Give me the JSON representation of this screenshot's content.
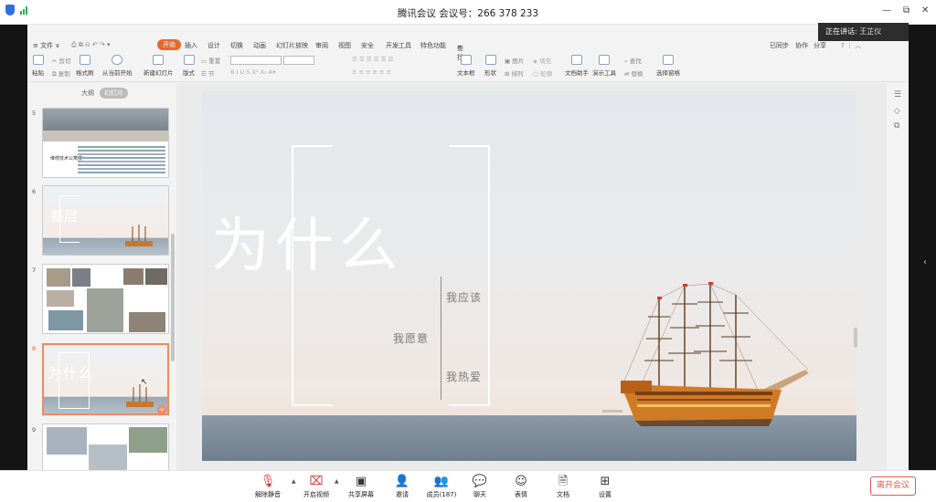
{
  "window": {
    "title": "腾讯会议 会议号：266 378 233",
    "minimize": "—",
    "restore": "⧉",
    "close": "✕"
  },
  "speaker": {
    "label": "正在讲话: ",
    "name": "王芷仪"
  },
  "wps": {
    "menu": {
      "file": "≡ 文件 ∨",
      "tabs": [
        "开始",
        "插入",
        "设计",
        "切换",
        "动画",
        "幻灯片放映",
        "审阅",
        "视图",
        "安全",
        "开发工具",
        "特色功能"
      ],
      "active_tab": "开始",
      "search": "查找",
      "sync": "已同步",
      "collab": "协作",
      "share": "分享"
    },
    "ribbon": {
      "paste": "粘贴",
      "cut": "剪切",
      "copy": "复制",
      "format_painter": "格式刷",
      "from_current": "从当前开始",
      "new_slide": "新建幻灯片",
      "layout": "版式",
      "section": "节",
      "reset": "重置",
      "textbox": "文本框",
      "shape": "形状",
      "arrange": "排列",
      "picture": "图片",
      "fill": "填充",
      "outline": "轮廓",
      "doc_assistant": "文档助手",
      "present_tool": "演示工具",
      "find": "查找",
      "replace": "替换",
      "select_pane": "选择窗格"
    },
    "panel": {
      "tab_outline": "大纲",
      "tab_slides": "幻灯片"
    },
    "thumbs": [
      {
        "num": "5",
        "text": "维修技术公寓楼"
      },
      {
        "num": "6",
        "text": "基层"
      },
      {
        "num": "7",
        "text": ""
      },
      {
        "num": "8",
        "text": "为什么"
      },
      {
        "num": "9",
        "text": ""
      }
    ],
    "slide": {
      "title": "为什么",
      "line1": "我应该",
      "line2": "我愿意",
      "line3": "我热爱"
    }
  },
  "bottom": {
    "items": [
      {
        "label": "解除静音",
        "icon": "mic-muted-icon"
      },
      {
        "label": "开启视频",
        "icon": "camera-off-icon"
      },
      {
        "label": "共享屏幕",
        "icon": "share-screen-icon"
      },
      {
        "label": "邀请",
        "icon": "invite-icon"
      },
      {
        "label": "成员(187)",
        "icon": "members-icon"
      },
      {
        "label": "聊天",
        "icon": "chat-icon"
      },
      {
        "label": "表情",
        "icon": "emoji-icon"
      },
      {
        "label": "文档",
        "icon": "document-icon"
      },
      {
        "label": "设置",
        "icon": "settings-icon"
      }
    ],
    "leave": "离开会议"
  }
}
